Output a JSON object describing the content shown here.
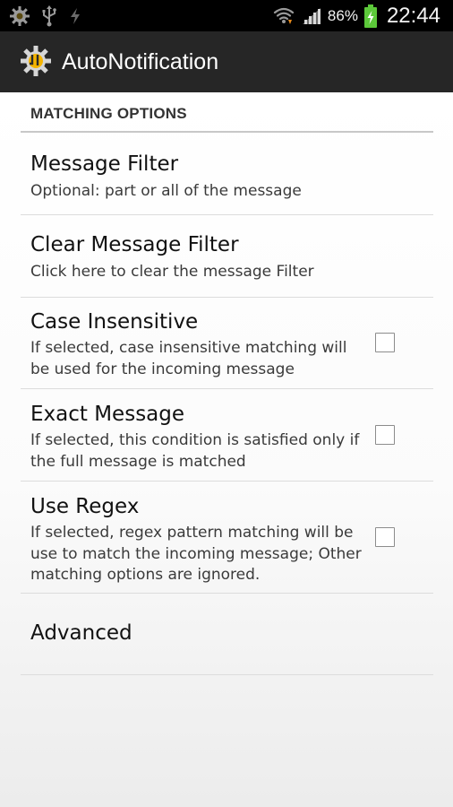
{
  "status_bar": {
    "left_icons": [
      "settings-notification-icon",
      "usb-icon",
      "charging-bolt-icon"
    ],
    "right_icons": [
      "wifi-icon",
      "signal-icon",
      "battery-icon"
    ],
    "battery_percent": "86%",
    "time": "22:44"
  },
  "action_bar": {
    "icon": "app-gear-icon",
    "title": "AutoNotification"
  },
  "section": {
    "header": "MATCHING OPTIONS"
  },
  "preferences": [
    {
      "title": "Message Filter",
      "summary": "Optional: part or all of the message"
    },
    {
      "title": "Clear Message Filter",
      "summary": "Click here to clear the message Filter"
    },
    {
      "title": "Case Insensitive",
      "summary": "If selected, case insensitive matching will be used for the incoming message",
      "checked": false
    },
    {
      "title": "Exact Message",
      "summary": "If selected, this condition is satisfied only if the full message is matched",
      "checked": false
    },
    {
      "title": "Use Regex",
      "summary": "If selected, regex pattern matching will be use to match the incoming message; Other matching options are ignored.",
      "checked": false
    },
    {
      "title": "Advanced"
    }
  ],
  "colors": {
    "status_bar_bg": "#000000",
    "action_bar_bg": "#262626",
    "battery_green": "#5cc83a",
    "text_primary": "#111111",
    "text_secondary": "#3a3a3a"
  }
}
